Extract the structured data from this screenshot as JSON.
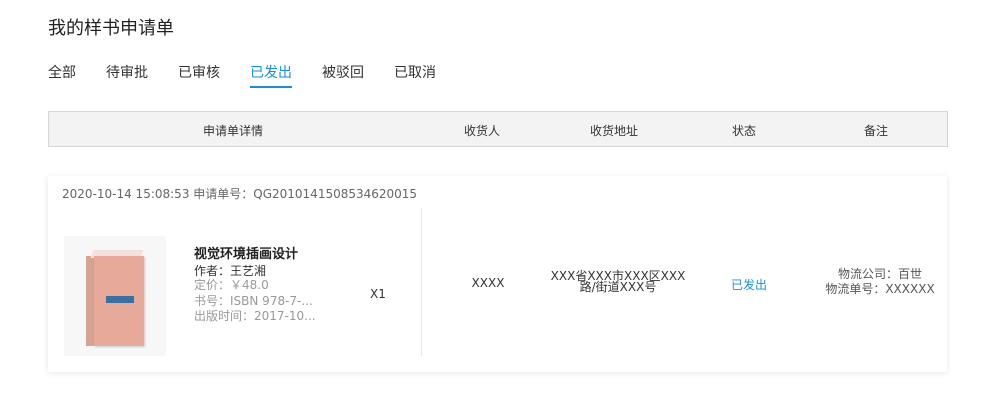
{
  "page_title": "我的样书申请单",
  "tabs": [
    {
      "label": "全部",
      "active": false
    },
    {
      "label": "待审批",
      "active": false
    },
    {
      "label": "已审核",
      "active": false
    },
    {
      "label": "已发出",
      "active": true
    },
    {
      "label": "被驳回",
      "active": false
    },
    {
      "label": "已取消",
      "active": false
    }
  ],
  "table": {
    "headers": {
      "detail": "申请单详情",
      "recipient": "收货人",
      "address": "收货地址",
      "status": "状态",
      "remark": "备注"
    }
  },
  "order": {
    "meta": "2020-10-14 15:08:53 申请单号：QG2010141508534620015",
    "book": {
      "title": "视觉环境插画设计",
      "author": "作者：王艺湘",
      "price": "定价：￥48.0",
      "isbn": "书号：ISBN 978-7-...",
      "publish_date": "出版时间：2017-10..."
    },
    "quantity": "X1",
    "recipient": "XXXX",
    "address_line1": "XXX省XXX市XXX区XXX",
    "address_line2": "路/街道XXX号",
    "status": "已发出",
    "logistics_company": "物流公司：百世",
    "tracking_number": "物流单号：XXXXXX"
  },
  "colors": {
    "accent": "#1c8fd4",
    "header_bg": "#f3f3f3",
    "book_cover": "#e7a99a",
    "muted_text": "#999999"
  }
}
